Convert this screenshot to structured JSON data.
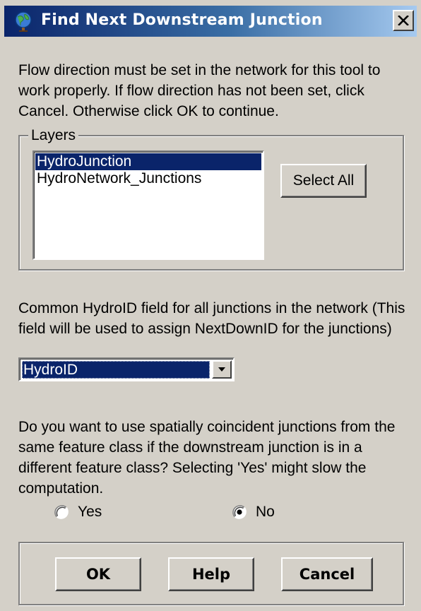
{
  "window": {
    "title": "Find Next Downstream Junction",
    "close_label": "X"
  },
  "intro_text": "Flow direction must be set in the network for this tool to work properly. If flow direction has not been set, click Cancel. Otherwise click OK to continue.",
  "layers_group": {
    "legend": "Layers",
    "items": [
      {
        "label": "HydroJunction",
        "selected": true
      },
      {
        "label": "HydroNetwork_Junctions",
        "selected": false
      }
    ],
    "select_all_label": "Select All"
  },
  "field_text": "Common HydroID field for all junctions in the network (This field will be used to assign NextDownID for the junctions)",
  "field_combo": {
    "selected_value": "HydroID"
  },
  "question_text": "Do you want to use spatially coincident junctions from the same feature class if the downstream junction is in a different feature class? Selecting 'Yes' might slow the computation.",
  "radio_options": [
    {
      "label": "Yes",
      "checked": false
    },
    {
      "label": "No",
      "checked": true
    }
  ],
  "buttons": {
    "ok_label": "OK",
    "help_label": "Help",
    "cancel_label": "Cancel"
  },
  "colors": {
    "titlebar_start": "#0a246a",
    "titlebar_end": "#a6caf0",
    "dialog_background": "#d4d0c8",
    "selection": "#0a246a"
  },
  "icons": {
    "title_icon": "globe-app-icon",
    "close_icon": "close-icon",
    "dropdown_icon": "chevron-down-icon"
  }
}
